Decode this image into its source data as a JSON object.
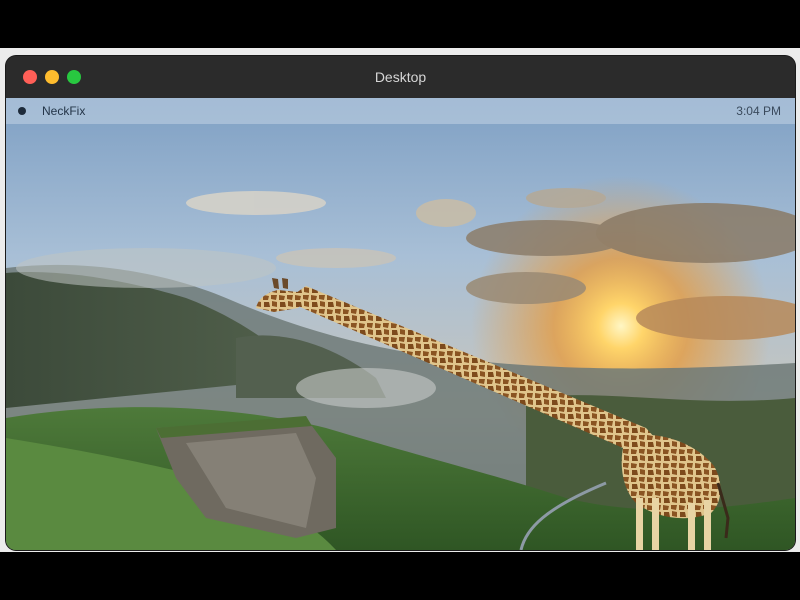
{
  "window": {
    "title": "Desktop",
    "controls": {
      "close_color": "#ff5f57",
      "minimize_color": "#febc2e",
      "zoom_color": "#28c840"
    }
  },
  "menubar": {
    "app_name": "NeckFix",
    "clock": "3:04 PM"
  },
  "wallpaper": {
    "icons": [
      "giraffe",
      "mountain-landscape",
      "sunset-sky"
    ]
  }
}
